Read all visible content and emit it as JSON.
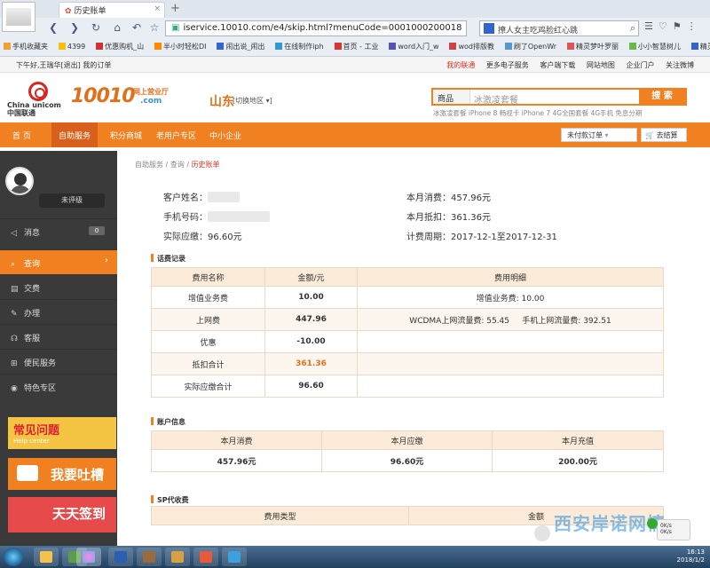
{
  "browser": {
    "tab_title": "历史账单",
    "url": "iservice.10010.com/e4/skip.html?menuCode=0001000200018",
    "search_text": "撩人女主吃鸡脸红心跳",
    "bookmarks": [
      "手机收藏夹",
      "4399",
      "优惠购机_山",
      "半小时轻松DI",
      "闹出说_闹出",
      "在线制作iph",
      "首页 - 工业",
      "word入门_w",
      "wod排版教",
      "刷了OpenWr",
      "精灵梦叶罗丽",
      "小小智慧树儿",
      "精灵梦叶罗丽"
    ]
  },
  "site_top": {
    "greeting": "下午好,王瑞华[退出]  我的订单",
    "links": [
      "我的联通",
      "更多电子服务",
      "客户端下载",
      "网站地图",
      "企业门户",
      "关注微博"
    ]
  },
  "header": {
    "logo_cn": "China unicom中国联通",
    "brand": "10010",
    "brand_sub": "网上营业厅",
    "brand_com": ".com",
    "region": "山东",
    "region_switch": "[切换地区 ▾]",
    "search_category": "商品",
    "search_placeholder": "冰激凌套餐",
    "search_button": "搜 索",
    "hot_words": "冰激凌套餐  iPhone 8  畅视卡  iPhone 7  4G全国套餐  4G手机  免息分期"
  },
  "main_nav": {
    "items": [
      "首 页",
      "自助服务",
      "积分商城",
      "老用户专区",
      "中小企业"
    ],
    "order_button": "未付款订单",
    "cart_button": "去结算"
  },
  "sidebar": {
    "level": "未评级",
    "items": [
      {
        "label": "消息",
        "badge": "0"
      },
      {
        "label": "查询"
      },
      {
        "label": "交费"
      },
      {
        "label": "办理"
      },
      {
        "label": "客服"
      },
      {
        "label": "便民服务"
      },
      {
        "label": "特色专区"
      }
    ],
    "promo1_title": "常见问题",
    "promo1_sub": "Help center",
    "promo2": "我要吐槽",
    "promo3": "天天签到"
  },
  "breadcrumb": {
    "items": [
      "自助服务",
      "查询"
    ],
    "current": "历史账单"
  },
  "bill_info": {
    "name_label": "客户姓名：",
    "phone_label": "手机号码：",
    "due_label": "实际应缴：",
    "due_value": "96.60元",
    "consume_label": "本月消费：",
    "consume_value": "457.96元",
    "deduct_label": "本月抵扣：",
    "deduct_value": "361.36元",
    "period_label": "计费周期：",
    "period_value": "2017-12-1至2017-12-31"
  },
  "call_records": {
    "title": "话费记录",
    "headers": [
      "费用名称",
      "金额/元",
      "费用明细"
    ],
    "rows": [
      [
        "增值业务费",
        "10.00",
        "增值业务费: 10.00"
      ],
      [
        "上网费",
        "447.96",
        "WCDMA上网流量费: 55.45     手机上网流量费: 392.51"
      ],
      [
        "优惠",
        "-10.00",
        ""
      ],
      [
        "抵扣合计",
        "361.36",
        ""
      ],
      [
        "实际应缴合计",
        "96.60",
        ""
      ]
    ]
  },
  "account_info": {
    "title": "账户信息",
    "headers": [
      "本月消费",
      "本月应缴",
      "本月充值"
    ],
    "values": [
      "457.96元",
      "96.60元",
      "200.00元"
    ]
  },
  "sp_fees": {
    "title": "SP代收费",
    "headers": [
      "费用类型",
      "金额"
    ]
  },
  "taskbar": {
    "tray_time": "16:13",
    "tray_date": "2018/1/2",
    "speed_up": "0K/s",
    "speed_down": "0K/s"
  },
  "watermark": "西安岸诺网情"
}
